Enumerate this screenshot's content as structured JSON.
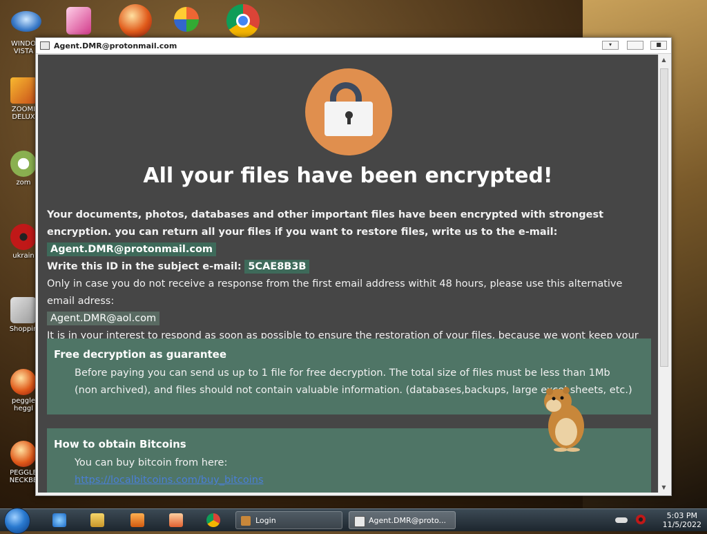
{
  "desktop": {
    "icons": [
      {
        "label": "WINDO VISTA"
      },
      {
        "label": "ZOOMI DELUX"
      },
      {
        "label": "zom"
      },
      {
        "label": "ukrain"
      },
      {
        "label": "Shoppin"
      },
      {
        "label": "peggle heggl"
      },
      {
        "label": "PEGGLE NECKBE"
      }
    ]
  },
  "window": {
    "title": "Agent.DMR@protonmail.com"
  },
  "note": {
    "headline": "All your files have been encrypted!",
    "para1": "Your documents, photos, databases and other important files have been encrypted with strongest encryption. you can return all your files if you want to restore files, write us to the e-mail:",
    "email_primary": "Agent.DMR@protonmail.com",
    "id_label": "Write this ID in the subject e-mail:",
    "id_value": "5CAE8B3B",
    "para2": "Only in case you do not receive a response from the first email address withit 48 hours, please use this alternative email adress:",
    "email_alt": "Agent.DMR@aol.com",
    "para3": "It is in your interest to respond as soon as possible to ensure the restoration of your files, because we wont keep your decryption keys at our server more than one week. The price depends on how fast you write to us."
  },
  "sections": [
    {
      "title": "Free decryption as guarantee",
      "body": "Before paying you can send us up to 1 file for free decryption. The total size of files must be less than 1Mb (non archived), and files should not contain valuable information. (databases,backups, large excel sheets, etc.)"
    },
    {
      "title": "How to obtain Bitcoins",
      "body": "You can buy bitcoin from here:",
      "link": "https://localbitcoins.com/buy_bitcoins"
    }
  ],
  "taskbar": {
    "tasks": [
      {
        "label": "Login"
      },
      {
        "label": "Agent.DMR@proto..."
      }
    ],
    "time": "5:03 PM",
    "date": "11/5/2022"
  }
}
